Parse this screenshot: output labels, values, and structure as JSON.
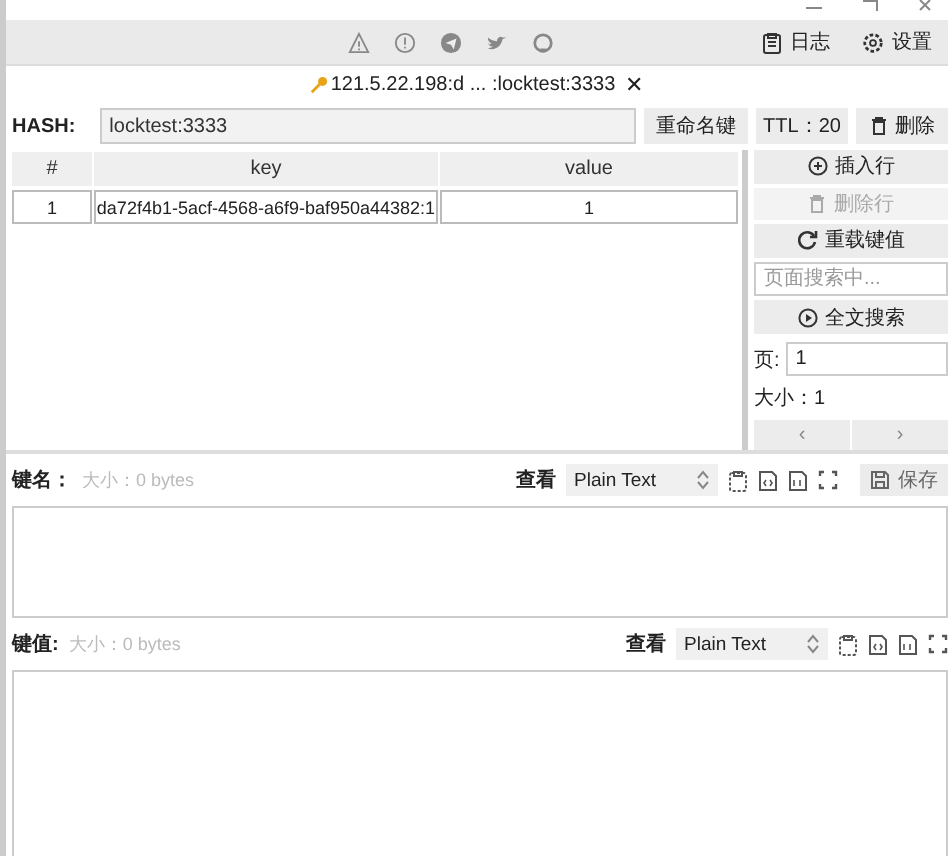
{
  "toolbar": {
    "buttons": [
      {
        "label": "日志",
        "kind": "log"
      },
      {
        "label": "设置",
        "kind": "settings"
      }
    ]
  },
  "tab": {
    "title": "121.5.22.198:d ... :locktest:3333",
    "close": "✕"
  },
  "hash": {
    "label": "HASH:",
    "value": "locktest:3333",
    "rename": "重命名键",
    "ttl": "TTL：20",
    "delete": "删除"
  },
  "table": {
    "columns": [
      "#",
      "key",
      "value"
    ],
    "rows": [
      {
        "index": "1",
        "key": "da72f4b1-5acf-4568-a6f9-baf950a44382:1",
        "value": "1"
      }
    ]
  },
  "actions": [
    {
      "label": "插入行",
      "kind": "insert",
      "disabled": false
    },
    {
      "label": "删除行",
      "kind": "delete",
      "disabled": true
    },
    {
      "label": "重载键值",
      "kind": "reload",
      "disabled": false
    }
  ],
  "page_search": {
    "placeholder": "页面搜索中..."
  },
  "full_search": "全文搜索",
  "pager": {
    "page_label": "页:",
    "page": "1",
    "size": "大小：1",
    "prev": "‹",
    "next": "›"
  },
  "editors": [
    {
      "label": "键名：",
      "size": "大小：0 bytes",
      "view_label": "查看",
      "format": "Plain Text",
      "save": "保存"
    },
    {
      "label": "键值:",
      "size": "大小：0 bytes",
      "view_label": "查看",
      "format": "Plain Text"
    }
  ]
}
